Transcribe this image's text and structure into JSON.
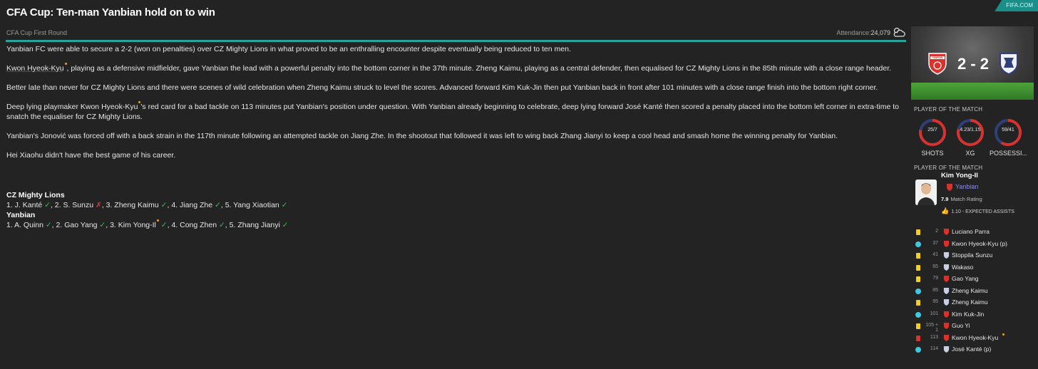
{
  "header": {
    "title": "CFA Cup: Ten-man Yanbian hold on to win",
    "source_tag": "FIFA.COM"
  },
  "subbar": {
    "competition": "CFA Cup First Round",
    "attendance_label": "Attendance:",
    "attendance_value": "24,079",
    "weather_icon": "partly-cloudy-icon"
  },
  "article": {
    "p1": "Yanbian FC were able to secure a 2-2 (won on penalties) over CZ Mighty Lions in what proved to be an enthralling encounter despite eventually being reduced to ten men.",
    "p2a": "Kwon Hyeok-Kyu",
    "p2b": ", playing as a defensive midfielder, gave Yanbian the lead with a powerful penalty into the bottom corner in the 37th minute. Zheng Kaimu, playing as a central defender, then equalised for CZ Mighty Lions in the 85th minute with a close range header.",
    "p3": "Better late than never for CZ Mighty Lions and there were scenes of wild celebration when Zheng Kaimu struck to level the scores. Advanced forward Kim Kuk-Jin then put Yanbian back in front after 101 minutes with a close range finish into the bottom right corner.",
    "p4a": "Deep lying playmaker Kwon Hyeok-Kyu",
    "p4b": "'s red card for a bad tackle on 113 minutes put Yanbian's position under question. With Yanbian already beginning to celebrate, deep lying forward José Kanté then scored a penalty placed into the bottom left corner in extra-time to snatch the equaliser for CZ Mighty Lions.",
    "p5": "Yanbian's Jonović was forced off with a back strain in the 117th minute following an attempted tackle on Jiang Zhe. In the shootout that followed it was left to wing back Zhang Jianyi to keep a cool head and smash home the winning penalty for Yanbian.",
    "p6": "Hei Xiaohu didn't have the best game of his career."
  },
  "penalties": {
    "team1": "CZ Mighty Lions",
    "team1_takers": [
      {
        "label": "1. J. Kanté",
        "result": "✓"
      },
      {
        "label": "2. S. Sunzu",
        "result": "✗"
      },
      {
        "label": "3. Zheng Kaimu",
        "result": "✓"
      },
      {
        "label": "4. Jiang Zhe",
        "result": "✓"
      },
      {
        "label": "5. Yang Xiaotian",
        "result": "✓"
      }
    ],
    "team2": "Yanbian",
    "team2_takers": [
      {
        "label": "1. A. Quinn",
        "result": "✓"
      },
      {
        "label": "2. Gao Yang",
        "result": "✓"
      },
      {
        "label": "3. Kim Yong-Il",
        "result": "✓"
      },
      {
        "label": "4. Cong Zhen",
        "result": "✓"
      },
      {
        "label": "5. Zhang Jianyi",
        "result": "✓"
      }
    ]
  },
  "scoreboard": {
    "home_short": "YANBIAN",
    "score": "2 - 2",
    "home_color": "#d8322c",
    "away_color": "#2f3f7a"
  },
  "stats": {
    "section_label": "PLAYER OF THE MATCH",
    "items": [
      {
        "value": "25/7",
        "label": "SHOTS",
        "home_share": 0.78
      },
      {
        "value": "4.23/1.15",
        "label": "XG",
        "home_share": 0.79
      },
      {
        "value": "59/41",
        "label": "POSSESSI...",
        "home_share": 0.59
      }
    ]
  },
  "potm": {
    "section_label": "PLAYER OF THE MATCH",
    "name": "Kim Yong-Il",
    "team": "Yanbian",
    "rating": "7.9",
    "rating_label": "Match Rating",
    "xa": "1.10 - EXPECTED ASSISTS"
  },
  "events": [
    {
      "type": "yellow",
      "minute": "2",
      "team": "home",
      "player": "Luciano Parra"
    },
    {
      "type": "goal",
      "minute": "37",
      "team": "home",
      "player": "Kwon Hyeok-Kyu (p)"
    },
    {
      "type": "yellow",
      "minute": "41",
      "team": "away",
      "player": "Stoppila Sunzu"
    },
    {
      "type": "yellow",
      "minute": "65",
      "team": "away",
      "player": "Wakaso"
    },
    {
      "type": "yellow",
      "minute": "79",
      "team": "home",
      "player": "Gao Yang"
    },
    {
      "type": "goal",
      "minute": "85",
      "team": "away",
      "player": "Zheng Kaimu"
    },
    {
      "type": "yellow",
      "minute": "95",
      "team": "away",
      "player": "Zheng Kaimu"
    },
    {
      "type": "goal",
      "minute": "101",
      "team": "home",
      "player": "Kim Kuk-Jin"
    },
    {
      "type": "yellow",
      "minute": "105 + 1",
      "team": "home",
      "player": "Guo Yi"
    },
    {
      "type": "red",
      "minute": "113",
      "team": "home",
      "player": "Kwon Hyeok-Kyu"
    },
    {
      "type": "goal",
      "minute": "114",
      "team": "away",
      "player": "José Kanté (p)"
    }
  ]
}
